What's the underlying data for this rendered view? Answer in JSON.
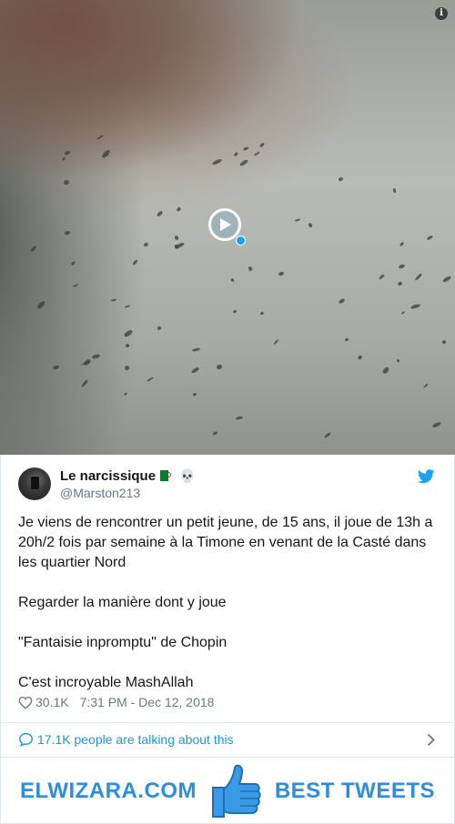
{
  "media": {
    "info_icon": "info-icon",
    "play_icon": "play-icon"
  },
  "author": {
    "name": "Le narcissique",
    "handle": "@Marston213",
    "badges": [
      "algeria-flag-emoji",
      "skull-emoji"
    ],
    "skull": "💀"
  },
  "tweet": {
    "paragraphs": [
      "Je viens de rencontrer un petit jeune, de 15 ans, il joue de 13h a 20h/2 fois par semaine à la Timone en venant de la Casté dans les quartier Nord",
      "Regarder la manière dont y joue",
      "\"Fantaisie inpromptu\" de Chopin",
      "C'est incroyable MashAllah"
    ],
    "likes": "30.1K",
    "timestamp": "7:31 PM - Dec 12, 2018"
  },
  "conversation": {
    "label": "17.1K people are talking about this"
  },
  "banner": {
    "left_text": "ELWIZARA.COM",
    "right_text": "BEST TWEETS",
    "icon": "thumbs-up-icon",
    "color": "#2e8de0"
  },
  "colors": {
    "twitter_blue": "#1da1f2",
    "link_blue": "#1b95e0",
    "text": "#14171a",
    "muted": "#657786"
  }
}
